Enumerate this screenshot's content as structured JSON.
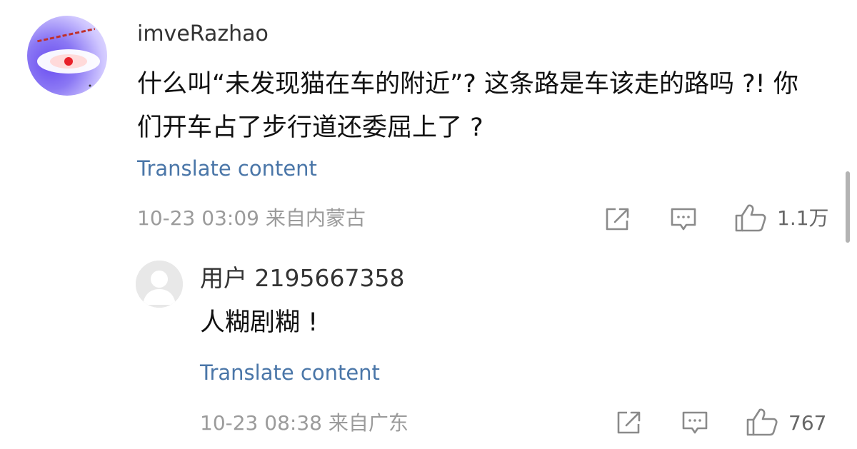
{
  "main_comment": {
    "username": "imveRazhao",
    "text": "什么叫“未发现猫在车的附近”? 这条路是车该走的路吗 ?! 你们开车占了步行道还委屈上了 ?",
    "translate_label": "Translate content",
    "meta": "10-23 03:09  来自内蒙古",
    "like_count": "1.1万",
    "icons": [
      "share-icon",
      "comment-icon",
      "thumbs-up-icon"
    ]
  },
  "reply": {
    "username": "用户 2195667358",
    "text": "人糊剧糊 !",
    "translate_label": "Translate content",
    "meta": "10-23 08:38  来自广东",
    "like_count": "767",
    "icons": [
      "share-icon",
      "comment-icon",
      "thumbs-up-icon"
    ]
  },
  "colors": {
    "link": "#4a76a8",
    "meta": "#9b9b9b",
    "icon": "#8a8a8a"
  }
}
